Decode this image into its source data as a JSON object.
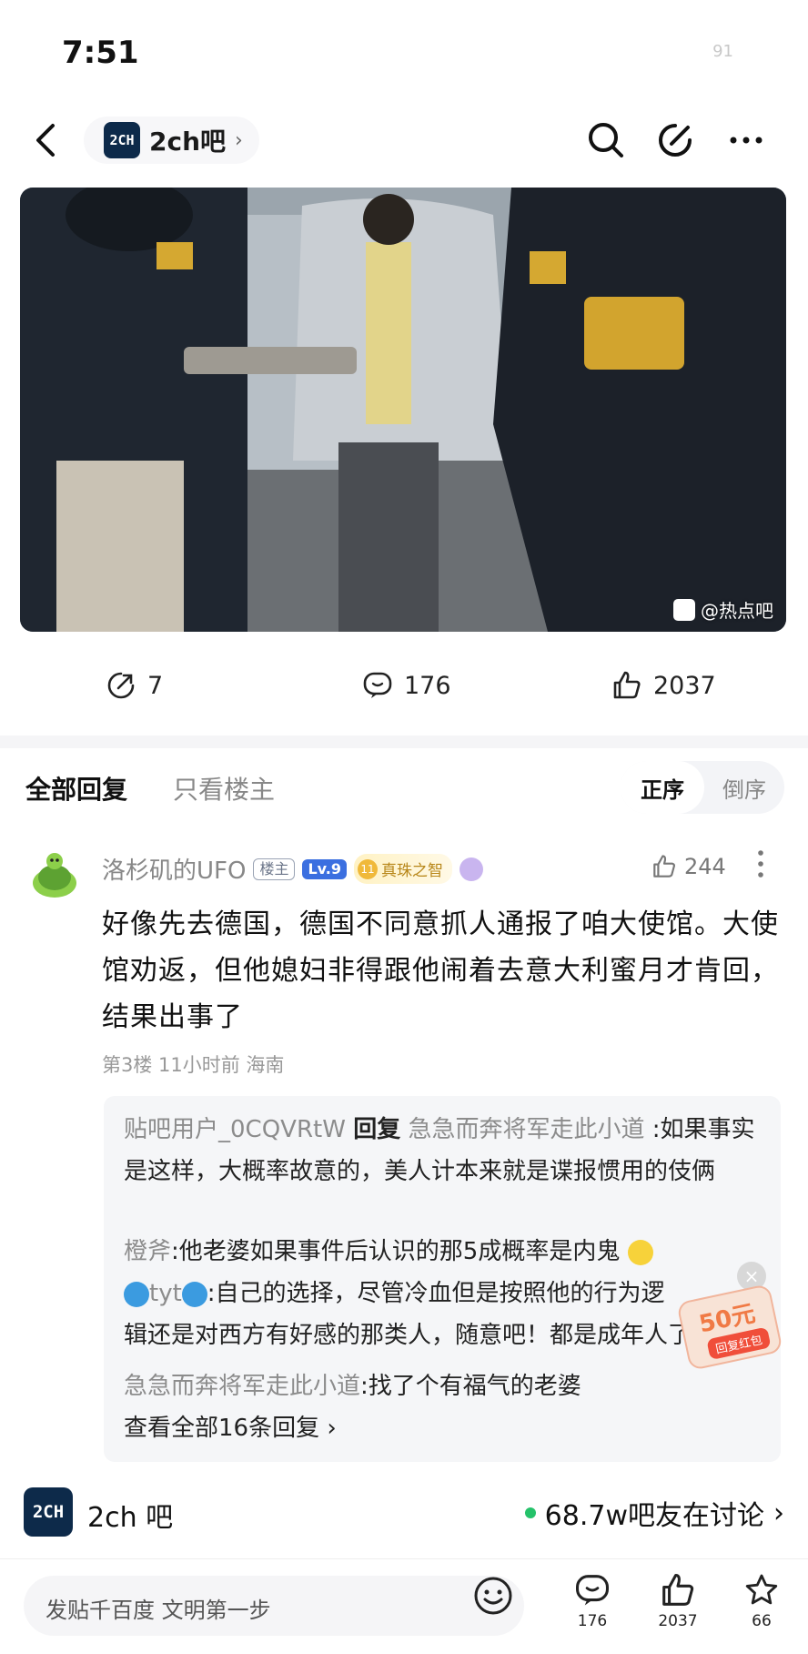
{
  "status": {
    "time": "7:51",
    "battery": "91"
  },
  "nav": {
    "forum_name": "2ch吧",
    "forum_arrow": "›",
    "logo_text": "2CH"
  },
  "photo": {
    "watermark": "@热点吧"
  },
  "actions": {
    "shares": "7",
    "comments": "176",
    "likes": "2037"
  },
  "tabs": {
    "all": "全部回复",
    "op_only": "只看楼主",
    "sort_asc": "正序",
    "sort_desc": "倒序"
  },
  "post": {
    "username": "洛杉矶的UFO",
    "badge_owner": "楼主",
    "badge_level": "Lv.9",
    "badge_title": "真珠之智",
    "title_coin": "11",
    "like_count": "244",
    "body": "好像先去德国，德国不同意抓人通报了咱大使馆。大使馆劝返，但他媳妇非得跟他闹着去意大利蜜月才肯回，结果出事了",
    "meta": "第3楼 11小时前 海南"
  },
  "replies": {
    "r1_user": "贴吧用户_0CQVRtW",
    "r1_verb": "回复",
    "r1_target": "急急而奔将军走此小道",
    "r1_text": ":如果事实是这样，大概率故意的，美人计本来就是谍报惯用的伎俩",
    "r2_user": "橙斧",
    "r2_text": ":他老婆如果事件后认识的那5成概率是内鬼",
    "r3_user": "tyt",
    "r3_text": ":自己的选择，尽管冷血但是按照他的行为逻",
    "r3_text2": "辑还是对西方有好感的那类人，随意吧！都是成年人了",
    "r4_user": "急急而奔将军走此小道",
    "r4_text": ":找了个有福气的老婆",
    "view_all": "查看全部16条回复 ›"
  },
  "redpacket": {
    "amount": "50元",
    "label": "回复红包",
    "close": "×"
  },
  "forum_bar": {
    "logo_text": "2CH",
    "name": "2ch 吧",
    "discussing": "68.7w吧友在讨论",
    "arrow": "›"
  },
  "bottom": {
    "placeholder": "发贴千百度 文明第一步",
    "comments": "176",
    "likes": "2037",
    "favs": "66"
  },
  "icons": {
    "back": "chevron-left-icon",
    "search": "search-icon",
    "edit": "edit-icon",
    "more": "more-icon",
    "share": "share-icon",
    "comment": "comment-icon",
    "like": "thumbs-up-icon",
    "favorite": "star-icon"
  },
  "colors": {
    "level_badge": "#3b6fe0",
    "online_dot": "#25c26a",
    "reply_bg": "#f5f6f8"
  }
}
